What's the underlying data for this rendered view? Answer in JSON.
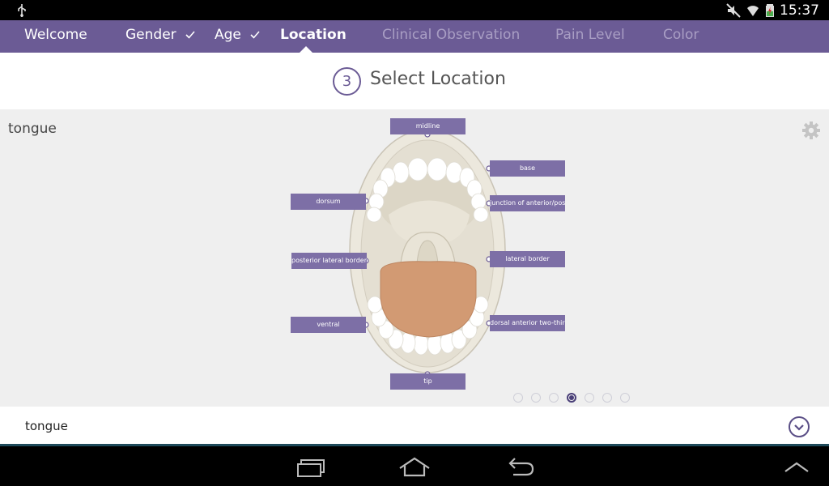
{
  "status": {
    "time": "15:37"
  },
  "nav": {
    "items": [
      {
        "label": "Welcome",
        "state": "done",
        "check": false
      },
      {
        "label": "Gender",
        "state": "done",
        "check": true
      },
      {
        "label": "Age",
        "state": "done",
        "check": true
      },
      {
        "label": "Location",
        "state": "active",
        "check": false
      },
      {
        "label": "Clinical Observation",
        "state": "disabled",
        "check": false
      },
      {
        "label": "Pain Level",
        "state": "disabled",
        "check": false
      },
      {
        "label": "Color",
        "state": "disabled",
        "check": false
      }
    ]
  },
  "header": {
    "step": "3",
    "title": "Select Location"
  },
  "main": {
    "label": "tongue",
    "tags": {
      "midline": "midline",
      "base": "base",
      "dorsum": "dorsum",
      "junction": "junction of anterior/posterior",
      "posterior_lateral": "posterior lateral border",
      "lateral": "lateral border",
      "ventral": "ventral",
      "dorsal_anterior": "dorsal anterior two-thirds",
      "tip": "tip"
    },
    "pager": {
      "count": 7,
      "active_index": 3
    }
  },
  "selection": {
    "value": "tongue"
  },
  "colors": {
    "brand": "#6b5b95",
    "tag": "#7d6fa6",
    "tongue": "#d29a73"
  }
}
